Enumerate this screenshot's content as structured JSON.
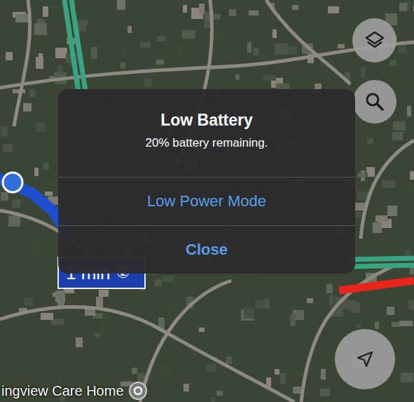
{
  "map": {
    "place_labels": [
      {
        "text": "ingview Care Home"
      }
    ],
    "route_badge": {
      "text": "1 min",
      "icon": "②"
    }
  },
  "alert": {
    "title": "Low Battery",
    "message": "20% battery remaining.",
    "buttons": [
      {
        "label": "Low Power Mode",
        "bold": false
      },
      {
        "label": "Close",
        "bold": true
      }
    ]
  }
}
